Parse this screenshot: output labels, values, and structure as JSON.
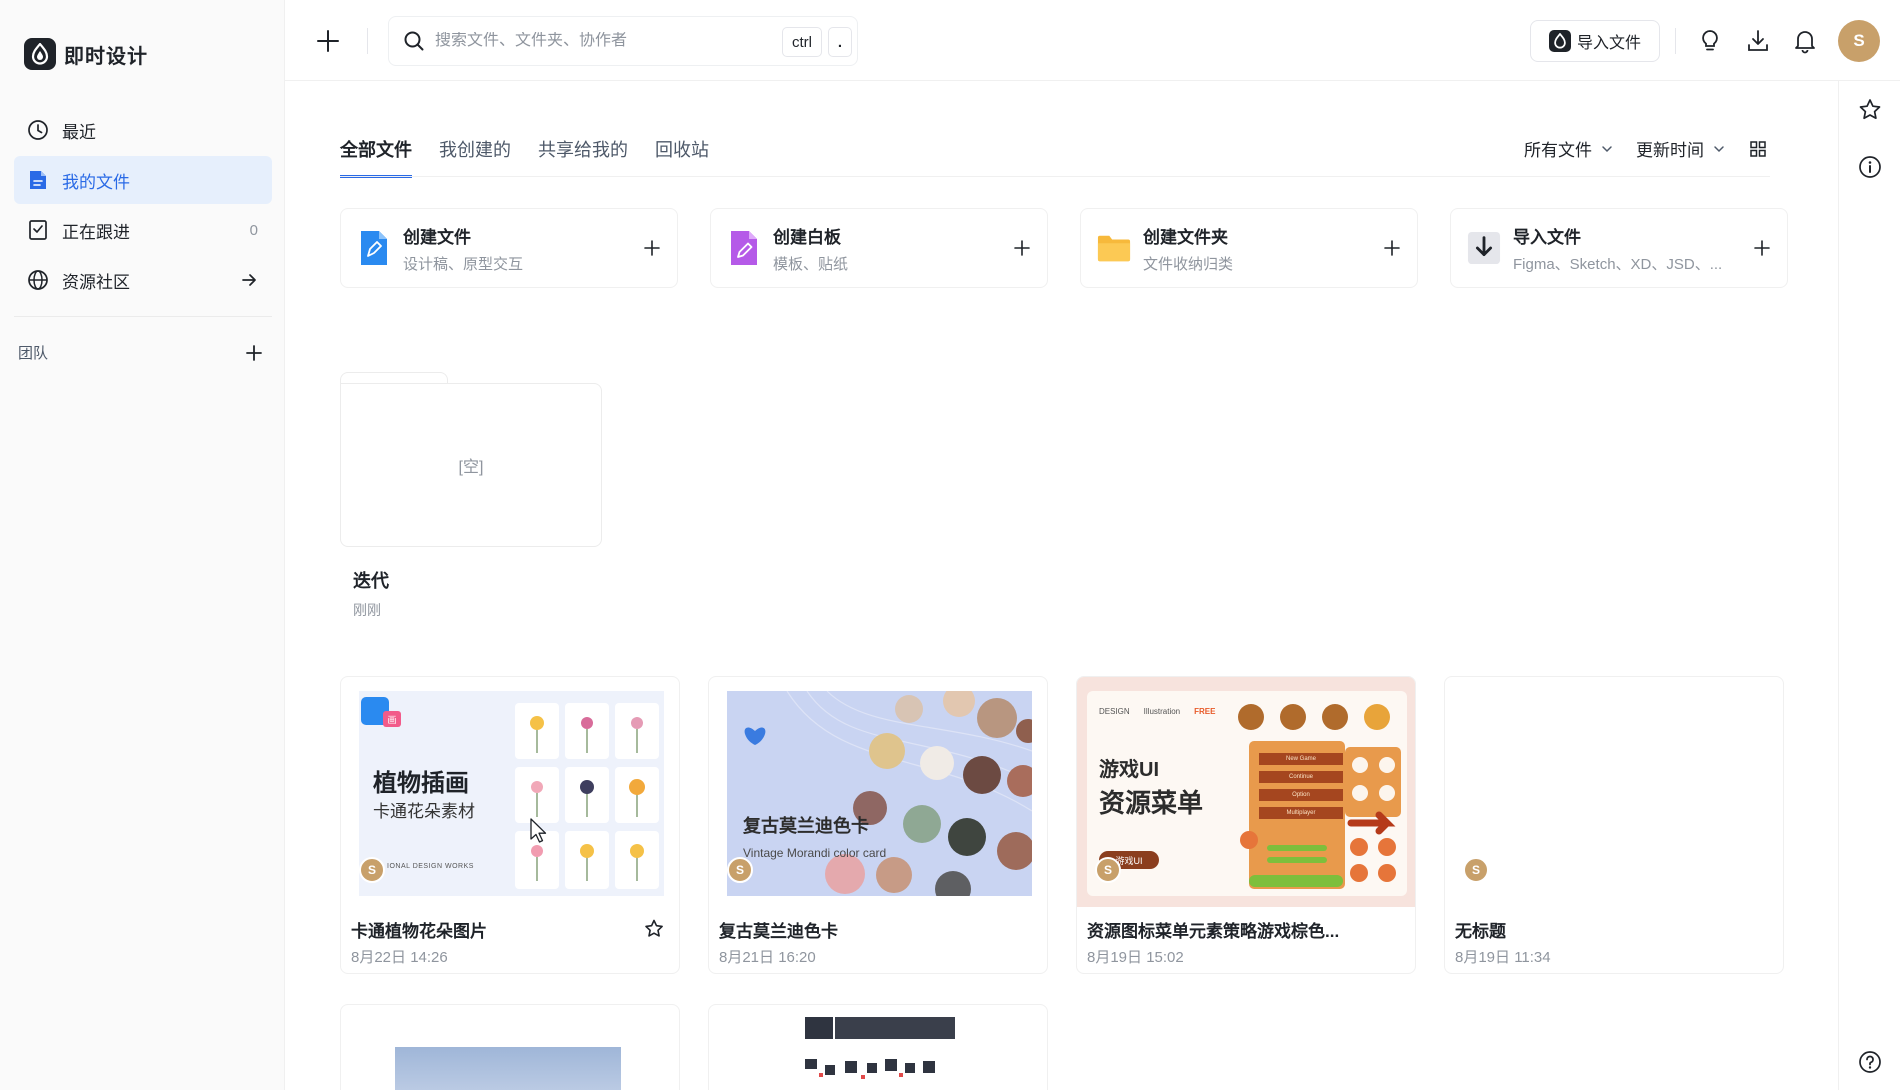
{
  "app": {
    "name": "即时设计"
  },
  "sidebar": {
    "items": [
      {
        "label": "最近",
        "icon": "clock-icon"
      },
      {
        "label": "我的文件",
        "icon": "file-icon",
        "active": true
      },
      {
        "label": "正在跟进",
        "icon": "bookmark-icon",
        "count": "0"
      },
      {
        "label": "资源社区",
        "icon": "globe-icon"
      }
    ],
    "team_label": "团队"
  },
  "topbar": {
    "search_placeholder": "搜索文件、文件夹、协作者",
    "shortcut_key1": "ctrl",
    "shortcut_key2": ".",
    "import_label": "导入文件",
    "avatar_letter": "S"
  },
  "tabs": [
    "全部文件",
    "我创建的",
    "共享给我的",
    "回收站"
  ],
  "filters": {
    "type": "所有文件",
    "sort": "更新时间"
  },
  "create_cards": [
    {
      "title": "创建文件",
      "subtitle": "设计稿、原型交互",
      "icon": "pen-file-icon"
    },
    {
      "title": "创建白板",
      "subtitle": "模板、贴纸",
      "icon": "whiteboard-icon"
    },
    {
      "title": "创建文件夹",
      "subtitle": "文件收纳归类",
      "icon": "folder-icon"
    },
    {
      "title": "导入文件",
      "subtitle": "Figma、Sketch、XD、JSD、...",
      "icon": "import-icon"
    }
  ],
  "folder": {
    "name": "迭代",
    "time": "刚刚",
    "empty_label": "[空]"
  },
  "files": [
    {
      "name": "卡通植物花朵图片",
      "time": "8月22日 14:26",
      "thumb_title": "植物插画",
      "thumb_sub": "卡通花朵素材",
      "thumb_foot": "IONAL DESIGN WORKS",
      "badge": "画"
    },
    {
      "name": "复古莫兰迪色卡",
      "time": "8月21日 16:20",
      "thumb_title": "复古莫兰迪色卡",
      "thumb_sub": "Vintage Morandi color card"
    },
    {
      "name": "资源图标菜单元素策略游戏棕色...",
      "time": "8月19日 15:02",
      "thumb_tags": [
        "DESIGN",
        "Illustration",
        "FREE"
      ],
      "thumb_title1": "游戏UI",
      "thumb_title2": "资源菜单",
      "thumb_pill": "游戏UI",
      "menu_items": [
        "New Game",
        "Continue",
        "Option",
        "Multiplayer"
      ]
    },
    {
      "name": "无标题",
      "time": "8月19日 11:34"
    }
  ],
  "owner_letter": "S",
  "colors": {
    "accent": "#2a6ae6",
    "active_bg": "#e6effc",
    "avatar": "#c8a06a"
  }
}
